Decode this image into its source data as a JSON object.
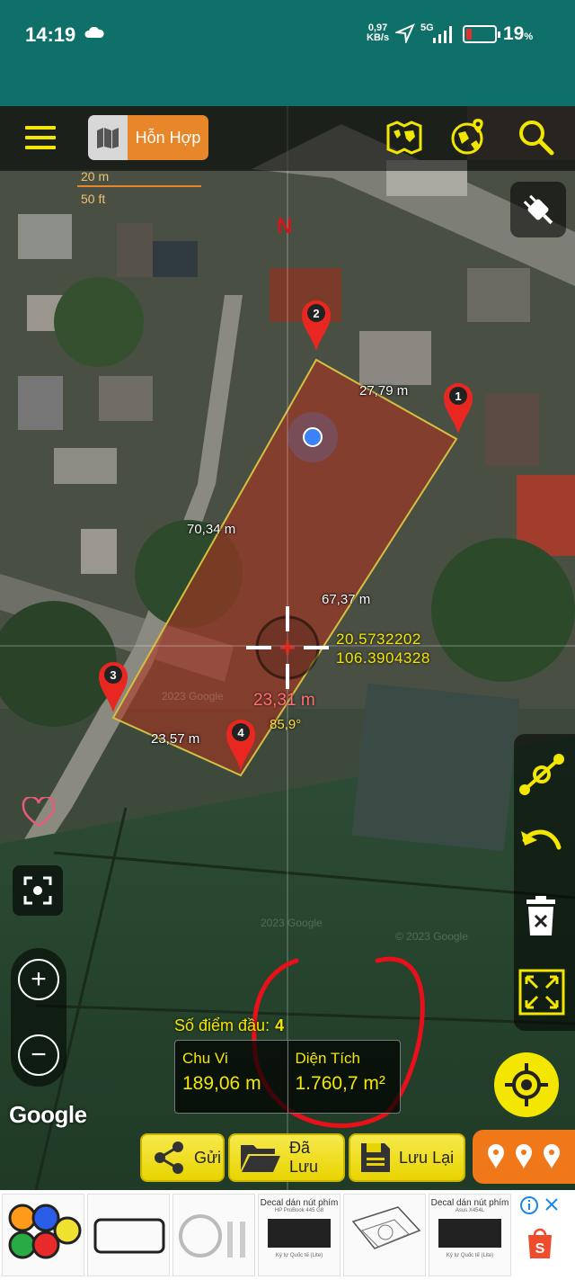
{
  "status": {
    "time": "14:19",
    "net_speed_value": "0,97",
    "net_speed_unit": "KB/s",
    "network": "5G",
    "battery": "19",
    "battery_unit": "%"
  },
  "toolbar": {
    "map_type_label": "Hỗn Hợp"
  },
  "scale": {
    "metric": "20 m",
    "imperial": "50 ft"
  },
  "compass_label": "N",
  "markers": [
    "1",
    "2",
    "3",
    "4"
  ],
  "measurements": {
    "side_1_2": "27,79 m",
    "side_2_3": "70,34 m",
    "side_4_1": "67,37 m",
    "side_3_4": "23,57 m",
    "current_segment": "23,31 m",
    "current_angle": "85,9°"
  },
  "coordinates": {
    "lat": "20.5732202",
    "lng": "106.3904328"
  },
  "watermarks": {
    "top": "2023 Google",
    "middle": "2023 Google",
    "bottom": "© 2023 Google"
  },
  "google_logo": "Google",
  "summary": {
    "point_count_label": "Số điểm đầu:",
    "point_count": "4",
    "perimeter_label": "Chu Vi",
    "perimeter_value": "189,06 m",
    "area_label": "Diện Tích",
    "area_value": "1.760,7 m²"
  },
  "actions": {
    "send": "Gửi",
    "saved": "Đã Lưu",
    "save": "Lưu Lại"
  },
  "ad": {
    "item3_title": "Decal dán nút phím",
    "item3_model": "HP ProBook 445 G8",
    "item3_foot": "Ký tự Quốc tế (Lite)",
    "item5_title": "Decal dán nút phím",
    "item5_model": "Asus X454L",
    "item5_foot": "Ký tự Quốc tế (Lite)"
  },
  "colors": {
    "status_bar": "#0e7068",
    "accent_yellow": "#f3e600",
    "map_type_orange": "#e8862a",
    "polygon_fill": "#9a2a1c",
    "annotation_red": "#e8101a"
  }
}
